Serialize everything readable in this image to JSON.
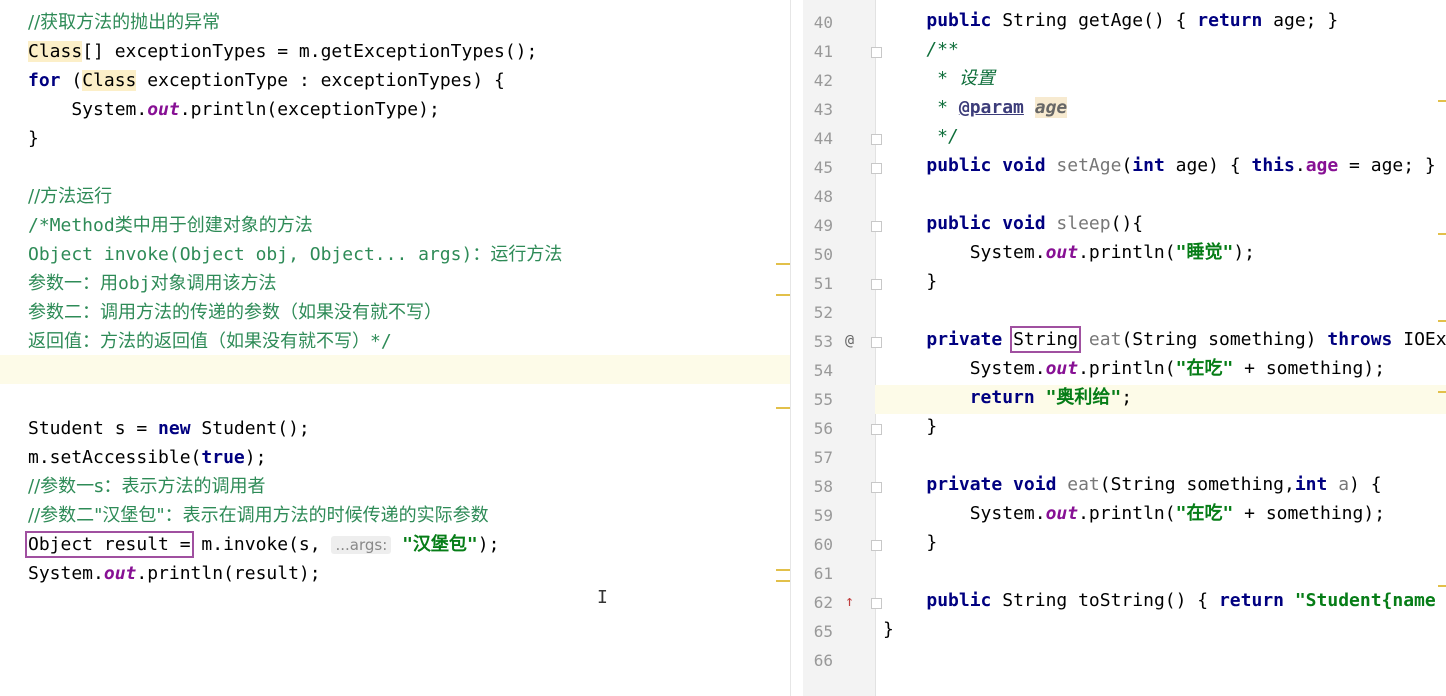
{
  "left_editor": {
    "lines": [
      {
        "id": "l1",
        "segs": [
          {
            "c": "cmcn",
            "t": "//获取方法的抛出的异常"
          }
        ]
      },
      {
        "id": "l2",
        "segs": [
          {
            "c": "cls",
            "t": "Class"
          },
          {
            "c": "",
            "t": "[] exceptionTypes = m.getExceptionTypes();"
          }
        ]
      },
      {
        "id": "l3",
        "segs": [
          {
            "c": "kw",
            "t": "for"
          },
          {
            "c": "",
            "t": " ("
          },
          {
            "c": "cls",
            "t": "Class"
          },
          {
            "c": "",
            "t": " exceptionType : exceptionTypes) {"
          }
        ]
      },
      {
        "id": "l4",
        "segs": [
          {
            "c": "",
            "t": "    System."
          },
          {
            "c": "it",
            "t": "out"
          },
          {
            "c": "",
            "t": ".println(exceptionType);"
          }
        ]
      },
      {
        "id": "l5",
        "segs": [
          {
            "c": "",
            "t": "}"
          }
        ]
      },
      {
        "id": "l6",
        "segs": []
      },
      {
        "id": "l7",
        "segs": [
          {
            "c": "cmcn",
            "t": "//方法运行"
          }
        ]
      },
      {
        "id": "l8",
        "segs": [
          {
            "c": "cm",
            "t": "/*Method"
          },
          {
            "c": "cmcn",
            "t": "类中用于创建对象的方法"
          }
        ]
      },
      {
        "id": "l9",
        "segs": [
          {
            "c": "cm",
            "t": "Object invoke(Object obj, Object... args)"
          },
          {
            "c": "cmcn",
            "t": "：运行方法"
          }
        ]
      },
      {
        "id": "l10",
        "segs": [
          {
            "c": "cmcn",
            "t": "参数一：用"
          },
          {
            "c": "cm",
            "t": "obj"
          },
          {
            "c": "cmcn",
            "t": "对象调用该方法"
          }
        ]
      },
      {
        "id": "l11",
        "segs": [
          {
            "c": "cmcn",
            "t": "参数二：调用方法的传递的参数（如果没有就不写）"
          }
        ]
      },
      {
        "id": "l12",
        "segs": [
          {
            "c": "cmcn",
            "t": "返回值：方法的返回值（如果没有就不写）"
          },
          {
            "c": "cm",
            "t": "*/"
          }
        ]
      },
      {
        "id": "l13",
        "segs": []
      },
      {
        "id": "l14",
        "segs": []
      },
      {
        "id": "l15",
        "segs": [
          {
            "c": "",
            "t": "Student s = "
          },
          {
            "c": "kw",
            "t": "new"
          },
          {
            "c": "",
            "t": " Student();"
          }
        ]
      },
      {
        "id": "l16",
        "segs": [
          {
            "c": "",
            "t": "m.setAccessible("
          },
          {
            "c": "kw",
            "t": "true"
          },
          {
            "c": "",
            "t": ");"
          }
        ]
      },
      {
        "id": "l17",
        "segs": [
          {
            "c": "cmcn",
            "t": "//参数一s：表示方法的调用者"
          }
        ]
      },
      {
        "id": "l18",
        "segs": [
          {
            "c": "cmcn",
            "t": "//参数二\"汉堡包\"：表示在调用方法的时候传递的实际参数"
          }
        ]
      },
      {
        "id": "l19",
        "segs": [
          {
            "c": "box",
            "t": "Object result ="
          },
          {
            "c": "",
            "t": " m.invoke(s, "
          },
          {
            "c": "hint",
            "t": "...args:"
          },
          {
            "c": "st",
            "t": " \"汉堡包\""
          },
          {
            "c": "",
            "t": ");"
          }
        ]
      },
      {
        "id": "l20",
        "segs": [
          {
            "c": "",
            "t": "System."
          },
          {
            "c": "it",
            "t": "out"
          },
          {
            "c": "",
            "t": ".println(result);"
          }
        ]
      }
    ]
  },
  "right_editor": {
    "lines": [
      {
        "num": "40",
        "segs": [
          {
            "c": "",
            "t": "    "
          },
          {
            "c": "kw",
            "t": "public"
          },
          {
            "c": "",
            "t": " String getAge() { "
          },
          {
            "c": "kw",
            "t": "return"
          },
          {
            "c": "",
            "t": " age; }"
          }
        ]
      },
      {
        "num": "41",
        "segs": [
          {
            "c": "doc",
            "t": "    /**"
          }
        ]
      },
      {
        "num": "42",
        "segs": [
          {
            "c": "doc",
            "t": "     * 设置"
          }
        ]
      },
      {
        "num": "43",
        "segs": [
          {
            "c": "doc",
            "t": "     * "
          },
          {
            "c": "doctag",
            "t": "@param"
          },
          {
            "c": "",
            "t": " "
          },
          {
            "c": "param",
            "t": "age"
          }
        ]
      },
      {
        "num": "44",
        "segs": [
          {
            "c": "doc",
            "t": "     */"
          }
        ]
      },
      {
        "num": "45",
        "segs": [
          {
            "c": "",
            "t": "    "
          },
          {
            "c": "kw",
            "t": "public void"
          },
          {
            "c": "gray",
            "t": " setAge"
          },
          {
            "c": "",
            "t": "("
          },
          {
            "c": "kw",
            "t": "int"
          },
          {
            "c": "",
            "t": " age) { "
          },
          {
            "c": "kw",
            "t": "this"
          },
          {
            "c": "",
            "t": "."
          },
          {
            "c": "fld",
            "t": "age"
          },
          {
            "c": "",
            "t": " = age; }"
          }
        ]
      },
      {
        "num": "48",
        "segs": []
      },
      {
        "num": "49",
        "segs": [
          {
            "c": "",
            "t": "    "
          },
          {
            "c": "kw",
            "t": "public void"
          },
          {
            "c": "gray",
            "t": " sleep"
          },
          {
            "c": "",
            "t": "(){"
          }
        ]
      },
      {
        "num": "50",
        "segs": [
          {
            "c": "",
            "t": "        System."
          },
          {
            "c": "it",
            "t": "out"
          },
          {
            "c": "",
            "t": ".println("
          },
          {
            "c": "st",
            "t": "\"睡觉\""
          },
          {
            "c": "",
            "t": ");"
          }
        ]
      },
      {
        "num": "51",
        "segs": [
          {
            "c": "",
            "t": "    }"
          }
        ]
      },
      {
        "num": "52",
        "segs": []
      },
      {
        "num": "53",
        "segs": [
          {
            "c": "",
            "t": "    "
          },
          {
            "c": "kw",
            "t": "private"
          },
          {
            "c": "",
            "t": " "
          },
          {
            "c": "box",
            "t": "String"
          },
          {
            "c": "gray",
            "t": " eat"
          },
          {
            "c": "",
            "t": "(String something) "
          },
          {
            "c": "kw",
            "t": "throws"
          },
          {
            "c": "",
            "t": " IOException"
          }
        ]
      },
      {
        "num": "54",
        "segs": [
          {
            "c": "",
            "t": "        System."
          },
          {
            "c": "it",
            "t": "out"
          },
          {
            "c": "",
            "t": ".println("
          },
          {
            "c": "st",
            "t": "\"在吃\""
          },
          {
            "c": "",
            "t": " + something);"
          }
        ]
      },
      {
        "num": "55",
        "segs": [
          {
            "c": "",
            "t": "        "
          },
          {
            "c": "kw",
            "t": "return"
          },
          {
            "c": "",
            "t": " "
          },
          {
            "c": "st",
            "t": "\"奥利给\""
          },
          {
            "c": "",
            "t": ";"
          }
        ]
      },
      {
        "num": "56",
        "segs": [
          {
            "c": "",
            "t": "    }"
          }
        ]
      },
      {
        "num": "57",
        "segs": []
      },
      {
        "num": "58",
        "segs": [
          {
            "c": "",
            "t": "    "
          },
          {
            "c": "kw",
            "t": "private void"
          },
          {
            "c": "gray",
            "t": " eat"
          },
          {
            "c": "",
            "t": "(String something,"
          },
          {
            "c": "kw",
            "t": "int"
          },
          {
            "c": "gray",
            "t": " a"
          },
          {
            "c": "",
            "t": ") {"
          }
        ]
      },
      {
        "num": "59",
        "segs": [
          {
            "c": "",
            "t": "        System."
          },
          {
            "c": "it",
            "t": "out"
          },
          {
            "c": "",
            "t": ".println("
          },
          {
            "c": "st",
            "t": "\"在吃\""
          },
          {
            "c": "",
            "t": " + something);"
          }
        ]
      },
      {
        "num": "60",
        "segs": [
          {
            "c": "",
            "t": "    }"
          }
        ]
      },
      {
        "num": "61",
        "segs": []
      },
      {
        "num": "62",
        "segs": [
          {
            "c": "",
            "t": "    "
          },
          {
            "c": "kw",
            "t": "public"
          },
          {
            "c": "",
            "t": " String toString() { "
          },
          {
            "c": "kw",
            "t": "return"
          },
          {
            "c": "",
            "t": " "
          },
          {
            "c": "st",
            "t": "\"Student{name"
          }
        ]
      },
      {
        "num": "65",
        "segs": [
          {
            "c": "",
            "t": "}"
          }
        ]
      },
      {
        "num": "66",
        "segs": []
      }
    ],
    "gutter_icons": {
      "at_symbol": "@",
      "override_arrow": "↑"
    }
  }
}
